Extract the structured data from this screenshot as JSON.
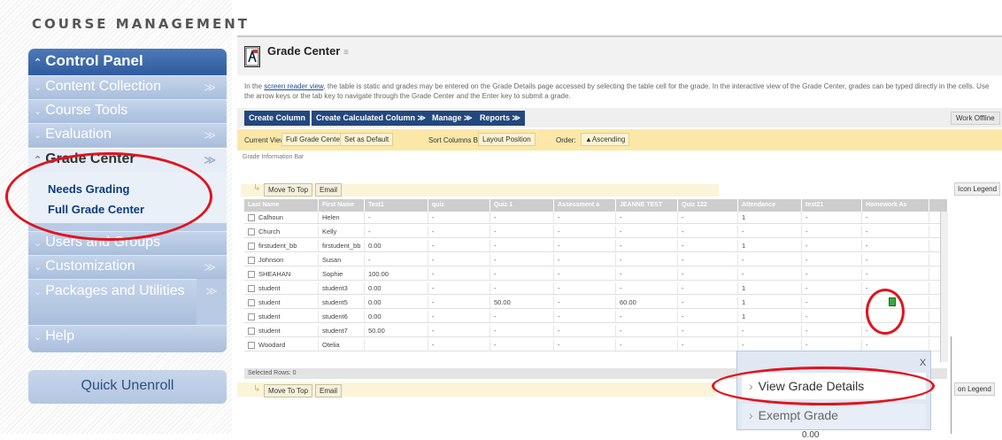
{
  "sidebar": {
    "section_title": "COURSE MANAGEMENT",
    "control_panel": "Control Panel",
    "items": [
      {
        "label": "Content Collection",
        "chev": "≫"
      },
      {
        "label": "Course Tools",
        "chev": ""
      },
      {
        "label": "Evaluation",
        "chev": "≫"
      }
    ],
    "grade_center": {
      "label": "Grade Center",
      "chev": "≫",
      "subitems": [
        "Needs Grading",
        "Full Grade Center"
      ]
    },
    "items2": [
      {
        "label": "Users and Groups",
        "chev": ""
      },
      {
        "label": "Customization",
        "chev": "≫"
      },
      {
        "label": "Packages and Utilities",
        "chev": "≫"
      },
      {
        "label": "Help",
        "chev": ""
      }
    ],
    "quick_unenroll": "Quick Unenroll"
  },
  "main": {
    "title": "Grade Center",
    "intro_link": "screen reader view",
    "intro_pre": "In the ",
    "intro_post": ", the table is static and grades may be entered on the Grade Details page accessed by selecting the table cell for the grade. In the interactive view of the Grade Center, grades can be typed directly in the cells. Use the arrow keys or the tab key to navigate through the Grade Center and the Enter key to submit a grade.",
    "buttons": [
      "Create Column",
      "Create Calculated Column ≫",
      "Manage ≫",
      "Reports ≫"
    ],
    "work_offline": "Work Offline",
    "view_label": "Current View:",
    "view_value": "Full Grade Center",
    "set_default": "Set as Default",
    "sort_label": "Sort Columns By:",
    "sort_value": "Layout Position",
    "order_label": "Order:",
    "order_value": "▲Ascending",
    "info_bar": "Grade Information Bar",
    "move_to_top": "Move To Top",
    "email": "Email",
    "icon_legend": "Icon Legend",
    "icon_legend_partial": "on Legend",
    "selected_rows": "Selected Rows: 0",
    "columns": [
      "Last Name",
      "First Name",
      "Test1",
      "quiz",
      "Quiz 1",
      "Assessment a",
      "JEANNE TEST",
      "Quiz 122",
      "Attendance",
      "test21",
      "Homework As"
    ],
    "rows": [
      [
        "Calhoun",
        "Helen",
        "-",
        "-",
        "-",
        "-",
        "-",
        "-",
        "1",
        "-",
        "-"
      ],
      [
        "Church",
        "Kelly",
        "-",
        "-",
        "-",
        "-",
        "-",
        "-",
        "-",
        "-",
        "-"
      ],
      [
        "firstudent_bb",
        "firstudent_bb",
        "0.00",
        "-",
        "-",
        "-",
        "-",
        "-",
        "1",
        "-",
        "-"
      ],
      [
        "Johnson",
        "Susan",
        "-",
        "-",
        "-",
        "-",
        "-",
        "-",
        "-",
        "-",
        "-"
      ],
      [
        "SHEAHAN",
        "Sophie",
        "100.00",
        "-",
        "-",
        "-",
        "-",
        "-",
        "-",
        "-",
        "-"
      ],
      [
        "student",
        "student3",
        "0.00",
        "-",
        "-",
        "-",
        "-",
        "-",
        "1",
        "-",
        "-"
      ],
      [
        "student",
        "student5",
        "0.00",
        "-",
        "50.00",
        "-",
        "60.00",
        "-",
        "1",
        "-",
        ""
      ],
      [
        "student",
        "student6",
        "0.00",
        "-",
        "-",
        "-",
        "-",
        "-",
        "1",
        "-",
        "-"
      ],
      [
        "student",
        "student7",
        "50.00",
        "-",
        "-",
        "-",
        "-",
        "-",
        "-",
        "-",
        "-"
      ],
      [
        "Woodard",
        "Otelia",
        "",
        "-",
        "-",
        "-",
        "-",
        "-",
        "-",
        "-",
        "-"
      ]
    ]
  },
  "popup": {
    "close": "X",
    "view_details": "View Grade Details",
    "exempt": "Exempt Grade",
    "behind": "0.00"
  }
}
